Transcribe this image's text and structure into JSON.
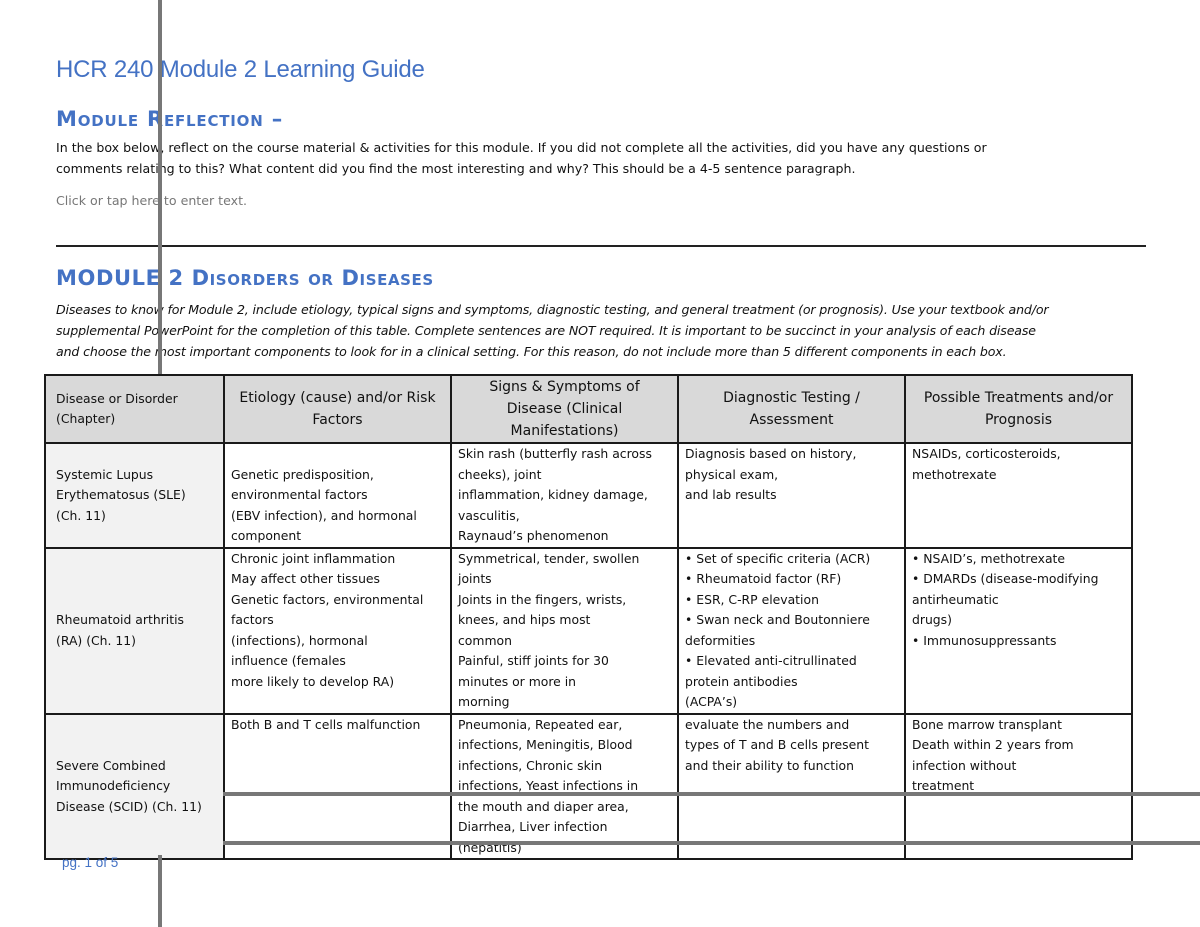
{
  "document": {
    "title": "HCR 240 Module 2 Learning Guide",
    "reflection": {
      "heading": "Module Reflection –",
      "instructions": [
        "In the box below, reflect on the course material & activities for this module.  If you did not complete all the activities, did you have any questions or",
        "comments relating to this?  What content did you find the most interesting and why?  This should be a 4-5 sentence paragraph."
      ],
      "input_placeholder": "Click or tap here to enter text."
    },
    "disorders": {
      "heading": "MODULE 2 Disorders or Diseases",
      "instructions": [
        "Diseases to know for Module 2, include etiology, typical signs and symptoms, diagnostic testing, and general treatment (or prognosis).  Use your textbook and/or",
        "supplemental PowerPoint for the completion of this table.  Complete sentences are NOT required.   It is important to be succinct in your analysis of each disease",
        "and choose the most important components to look for in a clinical setting. For this reason, do not include more than 5 different components in each box."
      ]
    },
    "table": {
      "headers": [
        "Disease or Disorder (Chapter)",
        "Etiology (cause) and/or Risk Factors",
        "Signs & Symptoms of Disease (Clinical Manifestations)",
        "Diagnostic Testing / Assessment",
        "Possible Treatments and/or Prognosis"
      ],
      "header_lines": [
        [
          "Disease or Disorder",
          "(Chapter)"
        ],
        [
          "Etiology (cause) and/or Risk",
          "Factors"
        ],
        [
          "Signs & Symptoms of",
          "Disease (Clinical",
          "Manifestations)"
        ],
        [
          "Diagnostic Testing /",
          "Assessment"
        ],
        [
          "Possible Treatments and/or",
          "Prognosis"
        ]
      ],
      "rows": [
        {
          "disease": [
            "Systemic Lupus",
            "Erythematosus (SLE)",
            "(Ch. 11)"
          ],
          "etiology": [
            "Genetic predisposition,",
            "environmental factors",
            "(EBV infection), and hormonal",
            "component"
          ],
          "signs": [
            "Skin rash (butterfly rash across",
            "cheeks), joint",
            "inflammation, kidney damage,",
            "vasculitis,",
            "Raynaud’s phenomenon"
          ],
          "diagnostic": [
            "Diagnosis based on history,",
            "physical exam,",
            "and lab results"
          ],
          "treatment": [
            "NSAIDs, corticosteroids,",
            "methotrexate"
          ]
        },
        {
          "disease": [
            "Rheumatoid arthritis",
            "(RA) (Ch. 11)"
          ],
          "etiology": [
            "Chronic joint inflammation",
            "May affect other tissues",
            "Genetic factors, environmental",
            "factors",
            "(infections), hormonal",
            "influence (females",
            "more likely to develop RA)"
          ],
          "signs": [
            "Symmetrical, tender, swollen",
            "joints",
            "Joints in the fingers, wrists,",
            "knees, and hips most",
            "common",
            "Painful, stiff joints for 30",
            "minutes or more in",
            "morning"
          ],
          "diagnostic": [
            "• Set of specific criteria (ACR)",
            "• Rheumatoid factor (RF)",
            "• ESR, C-RP elevation",
            "• Swan neck and Boutonniere",
            "deformities",
            "• Elevated anti-citrullinated",
            "protein antibodies",
            "(ACPA’s)"
          ],
          "treatment": [
            "• NSAID’s, methotrexate",
            "• DMARDs (disease-modifying",
            "antirheumatic",
            "drugs)",
            "• Immunosuppressants"
          ]
        },
        {
          "disease": [
            "Severe Combined",
            "Immunodeficiency",
            "Disease (SCID) (Ch. 11)"
          ],
          "etiology": [
            "Both B and T cells malfunction"
          ],
          "signs": [
            "Pneumonia, Repeated ear,",
            "infections, Meningitis, Blood",
            "infections, Chronic skin",
            "infections, Yeast infections in",
            "the mouth and diaper area,",
            "Diarrhea, Liver infection",
            "(hepatitis)"
          ],
          "diagnostic": [
            "evaluate the numbers and",
            "types of T and B cells present",
            "and their ability to function"
          ],
          "treatment": [
            "Bone marrow transplant",
            "Death within 2 years from",
            "infection without",
            "treatment"
          ]
        }
      ]
    },
    "footer": {
      "page_label": "pg. 1 of 5"
    }
  }
}
